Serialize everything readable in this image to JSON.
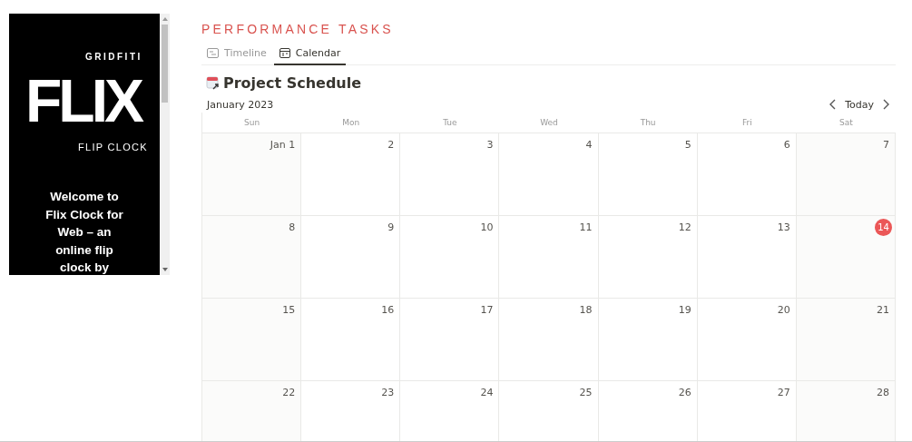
{
  "embed": {
    "brand": "GRIDFITI",
    "logo": "FLIX",
    "subtitle": "FLIP CLOCK",
    "welcome": "Welcome to Flix Clock for Web – an online flip clock by"
  },
  "page_title": "PERFORMANCE TASKS",
  "tabs": [
    {
      "label": "Timeline",
      "kind": "timeline",
      "selected": false
    },
    {
      "label": "Calendar",
      "kind": "calendar",
      "selected": true
    }
  ],
  "calendar": {
    "title": "Project Schedule",
    "month": "January 2023",
    "today_button": "Today",
    "weekdays": [
      "Sun",
      "Mon",
      "Tue",
      "Wed",
      "Thu",
      "Fri",
      "Sat"
    ],
    "weeks": [
      [
        {
          "label": "Jan 1",
          "today": false
        },
        {
          "label": "2",
          "today": false
        },
        {
          "label": "3",
          "today": false
        },
        {
          "label": "4",
          "today": false
        },
        {
          "label": "5",
          "today": false
        },
        {
          "label": "6",
          "today": false
        },
        {
          "label": "7",
          "today": false
        }
      ],
      [
        {
          "label": "8",
          "today": false
        },
        {
          "label": "9",
          "today": false
        },
        {
          "label": "10",
          "today": false
        },
        {
          "label": "11",
          "today": false
        },
        {
          "label": "12",
          "today": false
        },
        {
          "label": "13",
          "today": false
        },
        {
          "label": "14",
          "today": true
        }
      ],
      [
        {
          "label": "15",
          "today": false
        },
        {
          "label": "16",
          "today": false
        },
        {
          "label": "17",
          "today": false
        },
        {
          "label": "18",
          "today": false
        },
        {
          "label": "19",
          "today": false
        },
        {
          "label": "20",
          "today": false
        },
        {
          "label": "21",
          "today": false
        }
      ],
      [
        {
          "label": "22",
          "today": false
        },
        {
          "label": "23",
          "today": false
        },
        {
          "label": "24",
          "today": false
        },
        {
          "label": "25",
          "today": false
        },
        {
          "label": "26",
          "today": false
        },
        {
          "label": "27",
          "today": false
        },
        {
          "label": "28",
          "today": false
        }
      ]
    ]
  }
}
